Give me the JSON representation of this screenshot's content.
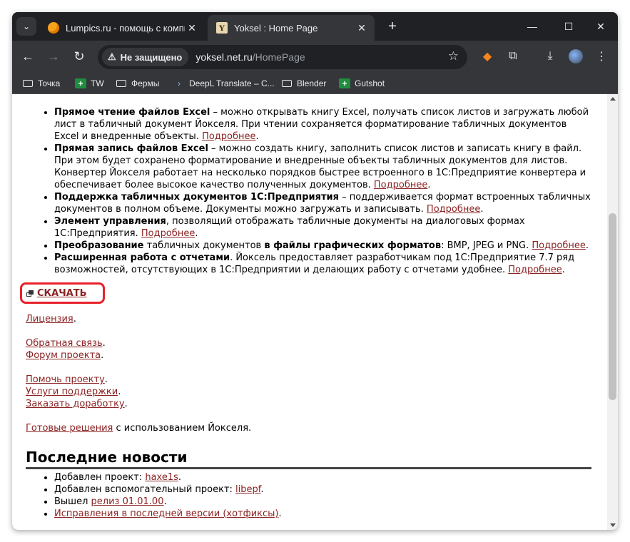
{
  "tabs": [
    {
      "title": "Lumpics.ru - помощь с компь",
      "close": "✕"
    },
    {
      "title": "Yoksel : Home Page",
      "close": "✕"
    }
  ],
  "window_controls": {
    "minimize": "—",
    "maximize": "☐",
    "close": "✕"
  },
  "omnibox": {
    "security_label": "Не защищено",
    "url_host": "yoksel.net.ru",
    "url_path": "/HomePage"
  },
  "bookmarks": [
    {
      "label": "Точка",
      "icon": "folder-icon"
    },
    {
      "label": "TW",
      "icon": "green-plus-icon"
    },
    {
      "label": "Фермы",
      "icon": "folder-icon"
    },
    {
      "label": "DeepL Translate – C...",
      "icon": "deepl-icon"
    },
    {
      "label": "Blender",
      "icon": "folder-icon"
    },
    {
      "label": "Gutshot",
      "icon": "green-plus-icon"
    }
  ],
  "features": [
    {
      "bold": "Прямое чтение файлов Excel",
      "text": " – можно открывать книгу Excel, получать список листов и загружать любой лист в табличный документ Йокселя. При чтении сохраняется форматирование табличных документов Excel и внедренные объекты. ",
      "link": "Подробнее"
    },
    {
      "bold": "Прямая запись файлов Excel",
      "text": " – можно создать книгу, заполнить список листов и записать книгу в файл. При этом будет сохранено форматирование и внедренные объекты табличных документов для листов. Конвертер Йокселя работает на несколько порядков быстрее встроенного в 1С:Предприятие конвертера и обеспечивает более высокое качество полученных документов. ",
      "link": "Подробнее"
    },
    {
      "bold": "Поддержка табличных документов 1С:Предприятия",
      "text": " – поддерживается формат встроенных табличных документов в полном объеме. Документы можно загружать и записывать. ",
      "link": "Подробнее"
    },
    {
      "bold": "Элемент управления",
      "text": ", позволящий отображать табличные документы на диалоговых формах 1С:Предприятия. ",
      "link": "Подробнее"
    },
    {
      "bold": "Преобразование",
      "text": " табличных документов ",
      "bold2": "в файлы графических форматов",
      "text2": ": BMP, JPEG и PNG. ",
      "link": "Подробнее"
    },
    {
      "bold": "Расширенная работа с отчетами",
      "text": ". Йоксель предоставляет разработчикам под 1С:Предприятие 7.7 ряд возможностей, отсутствующих в 1С:Предприятии и делающих работу с отчетами удобнее. ",
      "link": "Подробнее"
    }
  ],
  "download_label": "СКАЧАТЬ",
  "links": {
    "license": "Лицензия",
    "feedback": "Обратная связь",
    "forum": "Форум проекта",
    "help": "Помочь проекту",
    "support": "Услуги поддержки",
    "order": "Заказать доработку",
    "solutions": "Готовые решения",
    "solutions_suffix": " с использованием Йокселя."
  },
  "news": {
    "heading": "Последние новости",
    "items": [
      {
        "text": "Добавлен проект: ",
        "link": "haxe1s",
        "suffix": "."
      },
      {
        "text": "Добавлен вспомогательный проект: ",
        "link": "libepf",
        "suffix": "."
      },
      {
        "text": "Вышел ",
        "link": "релиз 01.01.00",
        "suffix": "."
      },
      {
        "text": "",
        "link": "Исправления в последней версии (хотфиксы)",
        "suffix": "."
      }
    ]
  },
  "colors": {
    "link": "#8b2323",
    "highlight": "#e8222b",
    "chrome_dark": "#202124",
    "chrome_toolbar": "#35363a"
  }
}
